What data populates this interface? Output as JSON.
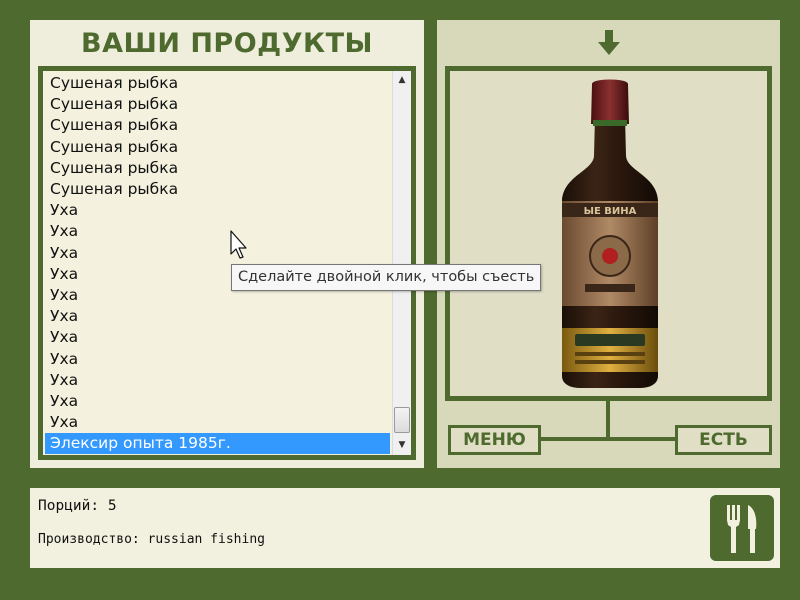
{
  "left_panel": {
    "title": "ВАШИ ПРОДУКТЫ",
    "items": [
      {
        "label": "Сушеная рыбка",
        "selected": false
      },
      {
        "label": "Сушеная рыбка",
        "selected": false
      },
      {
        "label": "Сушеная рыбка",
        "selected": false
      },
      {
        "label": "Сушеная рыбка",
        "selected": false
      },
      {
        "label": "Сушеная рыбка",
        "selected": false
      },
      {
        "label": "Сушеная рыбка",
        "selected": false
      },
      {
        "label": "Уха",
        "selected": false
      },
      {
        "label": "Уха",
        "selected": false
      },
      {
        "label": "Уха",
        "selected": false
      },
      {
        "label": "Уха",
        "selected": false
      },
      {
        "label": "Уха",
        "selected": false
      },
      {
        "label": "Уха",
        "selected": false
      },
      {
        "label": "Уха",
        "selected": false
      },
      {
        "label": "Уха",
        "selected": false
      },
      {
        "label": "Уха",
        "selected": false
      },
      {
        "label": "Уха",
        "selected": false
      },
      {
        "label": "Уха",
        "selected": false
      },
      {
        "label": "Элексир опыта 1985г.",
        "selected": true
      }
    ]
  },
  "tooltip": {
    "text": "Сделайте двойной клик, чтобы съесть"
  },
  "right_panel": {
    "arrow_icon": "arrow-down-icon",
    "preview_icon": "wine-bottle-image",
    "menu_label": "МЕНЮ",
    "eat_label": "ЕСТЬ"
  },
  "info": {
    "portions": "Порций: 5",
    "producer": "Производство: russian fishing",
    "icon": "fork-knife-icon"
  },
  "colors": {
    "background": "#4e6a2e",
    "panel": "#efeedd",
    "selection": "#3399ff"
  }
}
